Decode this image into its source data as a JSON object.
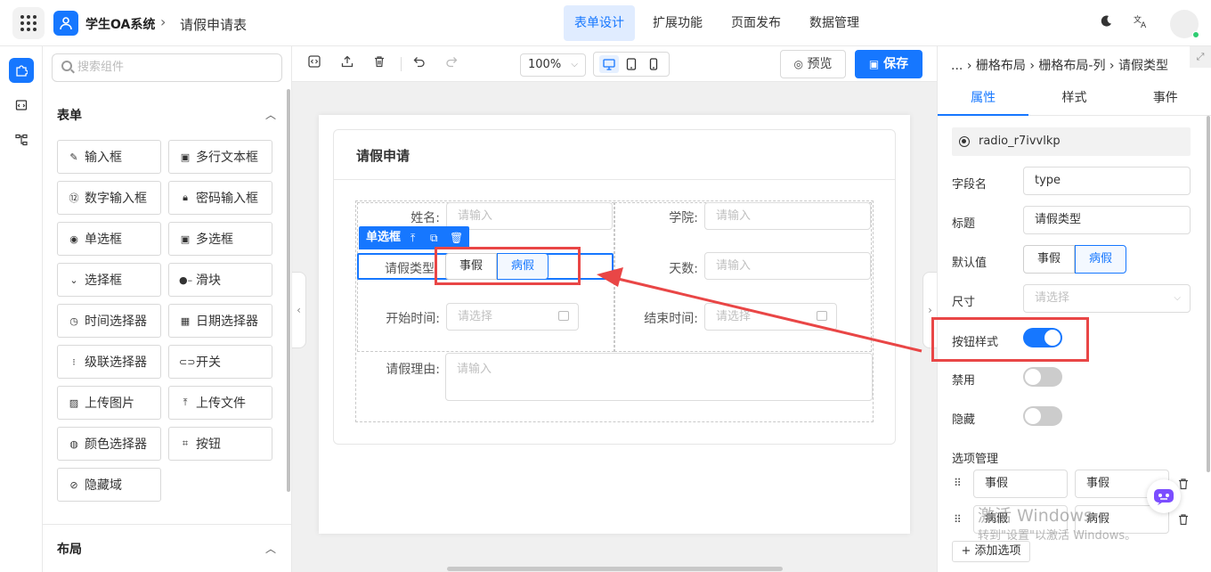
{
  "header": {
    "app_name": "学生OA系统",
    "page_name": "请假申请表",
    "nav": [
      "表单设计",
      "扩展功能",
      "页面发布",
      "数据管理"
    ],
    "active_nav": "表单设计"
  },
  "components": {
    "search_placeholder": "搜索组件",
    "form_section": "表单",
    "layout_section": "布局",
    "items": [
      {
        "label": "输入框",
        "icon": "edit-icon"
      },
      {
        "label": "多行文本框",
        "icon": "textarea-icon"
      },
      {
        "label": "数字输入框",
        "icon": "number-icon"
      },
      {
        "label": "密码输入框",
        "icon": "lock-icon"
      },
      {
        "label": "单选框",
        "icon": "radio-icon"
      },
      {
        "label": "多选框",
        "icon": "checkbox-icon"
      },
      {
        "label": "选择框",
        "icon": "select-icon"
      },
      {
        "label": "滑块",
        "icon": "slider-icon"
      },
      {
        "label": "时间选择器",
        "icon": "clock-icon"
      },
      {
        "label": "日期选择器",
        "icon": "calendar-icon"
      },
      {
        "label": "级联选择器",
        "icon": "cascader-icon"
      },
      {
        "label": "开关",
        "icon": "switch-icon"
      },
      {
        "label": "上传图片",
        "icon": "image-icon"
      },
      {
        "label": "上传文件",
        "icon": "upload-icon"
      },
      {
        "label": "颜色选择器",
        "icon": "palette-icon"
      },
      {
        "label": "按钮",
        "icon": "button-icon"
      },
      {
        "label": "隐藏域",
        "icon": "eye-off-icon"
      }
    ]
  },
  "toolbar": {
    "zoom": "100%",
    "preview_label": "预览",
    "save_label": "保存"
  },
  "form": {
    "title": "请假申请",
    "name_label": "姓名:",
    "name_placeholder": "请输入",
    "college_label": "学院:",
    "college_placeholder": "请输入",
    "type_label": "请假类型",
    "type_options": [
      "事假",
      "病假"
    ],
    "type_selected": "病假",
    "days_label": "天数:",
    "days_placeholder": "请输入",
    "start_label": "开始时间:",
    "start_placeholder": "请选择",
    "end_label": "结束时间:",
    "end_placeholder": "请选择",
    "reason_label": "请假理由:",
    "reason_placeholder": "请输入",
    "selected_tag": "单选框"
  },
  "props": {
    "breadcrumb": [
      "...",
      "栅格布局",
      "栅格布局-列",
      "请假类型"
    ],
    "tabs": [
      "属性",
      "样式",
      "事件"
    ],
    "active_tab": "属性",
    "component_id": "radio_r7ivvlkp",
    "field_label": "字段名",
    "field_value": "type",
    "title_label": "标题",
    "title_value": "请假类型",
    "default_label": "默认值",
    "default_options": [
      "事假",
      "病假"
    ],
    "default_selected": "病假",
    "size_label": "尺寸",
    "size_placeholder": "请选择",
    "button_style_label": "按钮样式",
    "button_style_on": true,
    "disabled_label": "禁用",
    "disabled_on": false,
    "hidden_label": "隐藏",
    "hidden_on": false,
    "options_label": "选项管理",
    "options": [
      {
        "label": "事假",
        "value": "事假"
      },
      {
        "label": "病假",
        "value": "病假"
      }
    ],
    "add_option_label": "+ 添加选项"
  },
  "watermark": {
    "line1": "激活 Windows",
    "line2": "转到\"设置\"以激活 Windows。"
  },
  "colors": {
    "accent": "#1677ff",
    "highlight": "#e94646"
  }
}
